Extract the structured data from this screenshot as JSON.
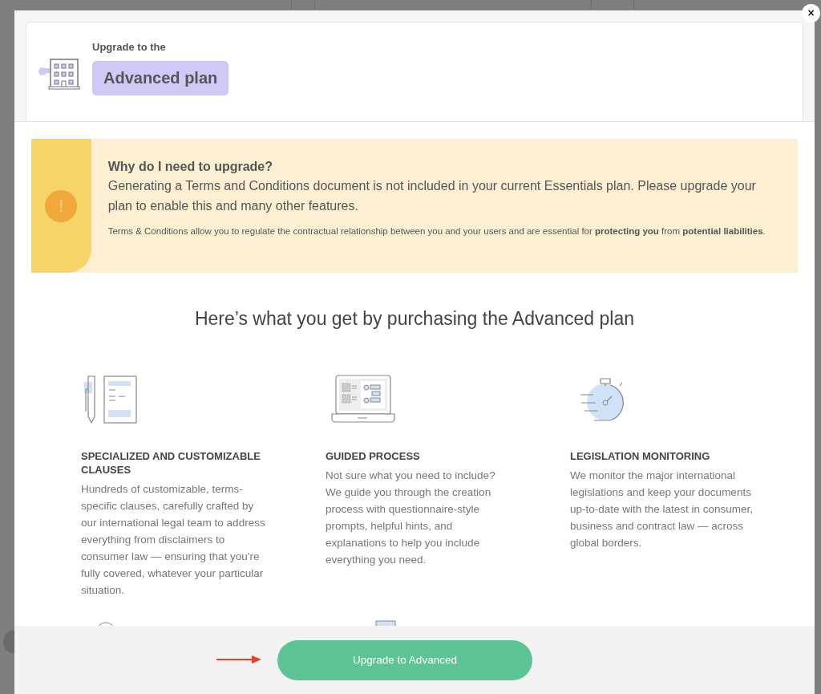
{
  "modal": {
    "close": "×",
    "header": {
      "eyebrow": "Upgrade to the",
      "plan": "Advanced plan"
    },
    "notice": {
      "icon": "!",
      "title": "Why do I need to upgrade?",
      "message": "Generating a Terms and Conditions document is not included in your current Essentials plan. Please upgrade your plan to enable this and many other features.",
      "note": "Terms & Conditions allow you to regulate the contractual relationship between you and your users and are essential for **protecting you** from **potential liabilities**."
    },
    "heading": "Here’s what you get by purchasing the Advanced plan",
    "features": [
      {
        "kind": "clauses",
        "title": "SPECIALIZED AND CUSTOMIZABLE CLAUSES",
        "text": "Hundreds of customizable, terms-specific clauses, carefully crafted by our international legal team to address everything from disclaimers to consumer law — ensuring that you're fully covered, whatever your particular situation."
      },
      {
        "kind": "guided",
        "title": "GUIDED PROCESS",
        "text": "Not sure what you need to include? We guide you through the creation process with questionnaire-style prompts, helpful hints, and explanations to help you include everything you need."
      },
      {
        "kind": "monitoring",
        "title": "LEGISLATION MONITORING",
        "text": "We monitor the major international legislations and keep your documents up-to-date with the latest in consumer, business and contract law — across global borders."
      }
    ],
    "footer": {
      "button": "Upgrade to Advanced"
    }
  }
}
